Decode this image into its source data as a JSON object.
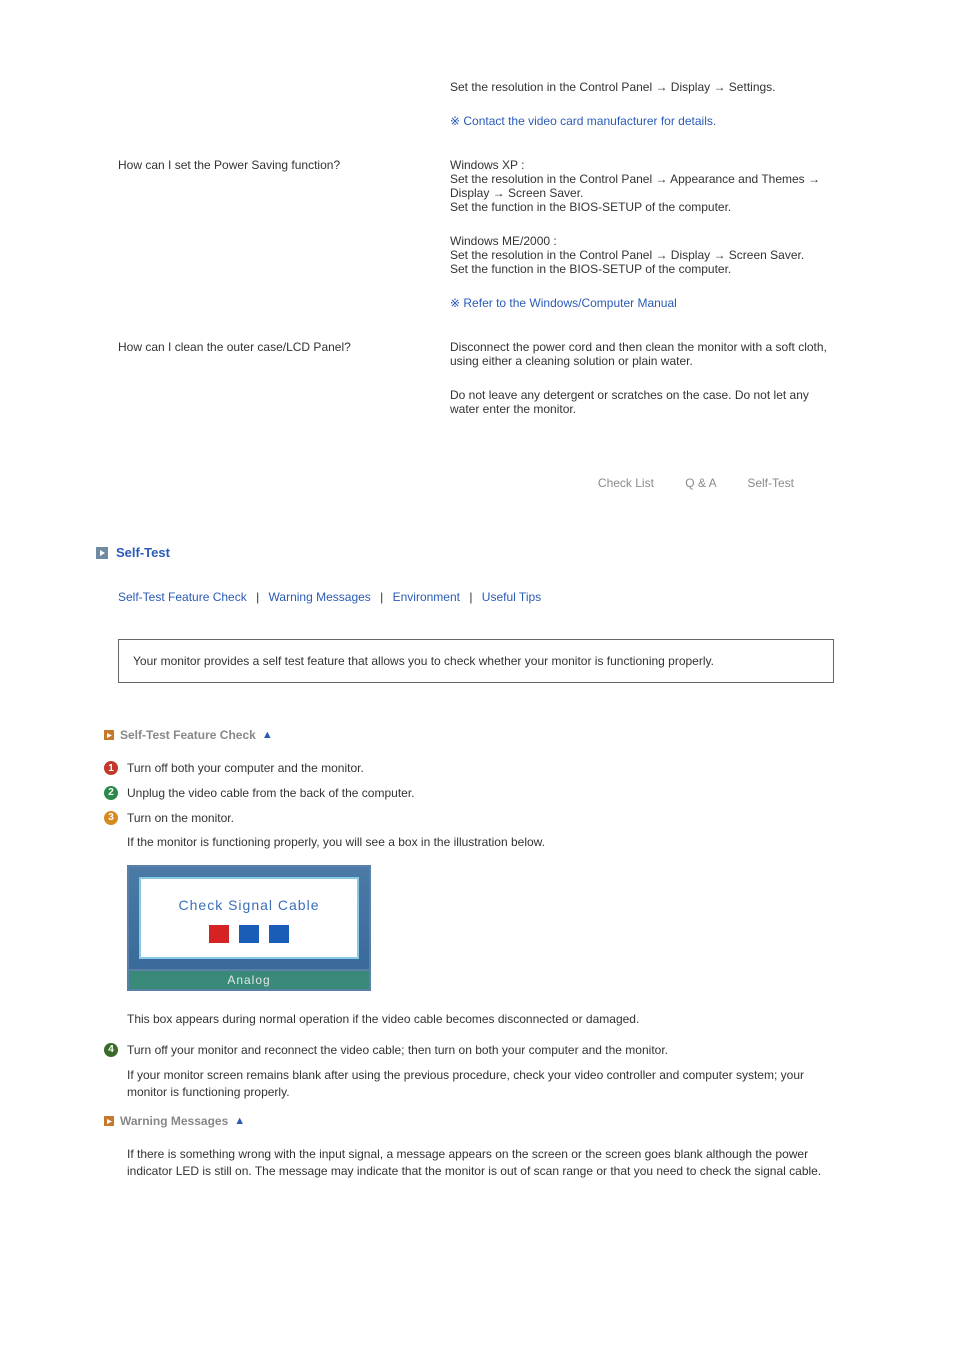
{
  "qa": {
    "resolution": {
      "a": "Set the resolution in the Control Panel → Display → Settings.",
      "note": "Contact the video card manufacturer for details."
    },
    "powersaving": {
      "q": "How can I set the Power Saving function?",
      "xp_label": "Windows XP :",
      "xp_a1": "Set the resolution in the Control Panel → Appearance and Themes → Display → Screen Saver.",
      "xp_a2": "Set the function in the BIOS-SETUP of the computer.",
      "me_label": "Windows ME/2000 :",
      "me_a1": "Set the resolution in the Control Panel → Display → Screen Saver.",
      "me_a2": "Set the function in the BIOS-SETUP of the computer.",
      "note": "Refer to the Windows/Computer Manual"
    },
    "clean": {
      "q": "How can I clean the outer case/LCD Panel?",
      "a1": "Disconnect the power cord and then clean the monitor with a soft cloth, using either a cleaning solution or plain water.",
      "a2": "Do not leave any detergent or scratches on the case. Do not let any water enter the monitor."
    }
  },
  "nav": {
    "checklist": "Check List",
    "qa": "Q & A",
    "selftest": "Self-Test"
  },
  "section": {
    "title": "Self-Test"
  },
  "sublinks": {
    "a": "Self-Test Feature Check",
    "b": "Warning Messages",
    "c": "Environment",
    "d": "Useful Tips"
  },
  "infobox": "Your monitor provides a self test feature that allows you to check whether your monitor is functioning properly.",
  "sub1": {
    "title": "Self-Test Feature Check",
    "step1": "Turn off both your computer and the monitor.",
    "step2": "Unplug the video cable from the back of the computer.",
    "step3": "Turn on the monitor.",
    "post3": "If the monitor is functioning properly, you will see a box in the illustration below.",
    "box_label": "Check Signal Cable",
    "box_footer": "Analog",
    "post_box": "This box appears during normal operation if the video cable becomes disconnected or damaged.",
    "step4": "Turn off your monitor and reconnect the video cable; then turn on both your computer and the monitor.",
    "post4": "If your monitor screen remains blank after using the previous procedure, check your video controller and computer system; your monitor is functioning properly."
  },
  "sub2": {
    "title": "Warning Messages",
    "body": "If there is something wrong with the input signal, a message appears on the screen or the screen goes blank although the power indicator LED is still on. The message may indicate that the monitor is out of scan range or that you need to check the signal cable."
  }
}
